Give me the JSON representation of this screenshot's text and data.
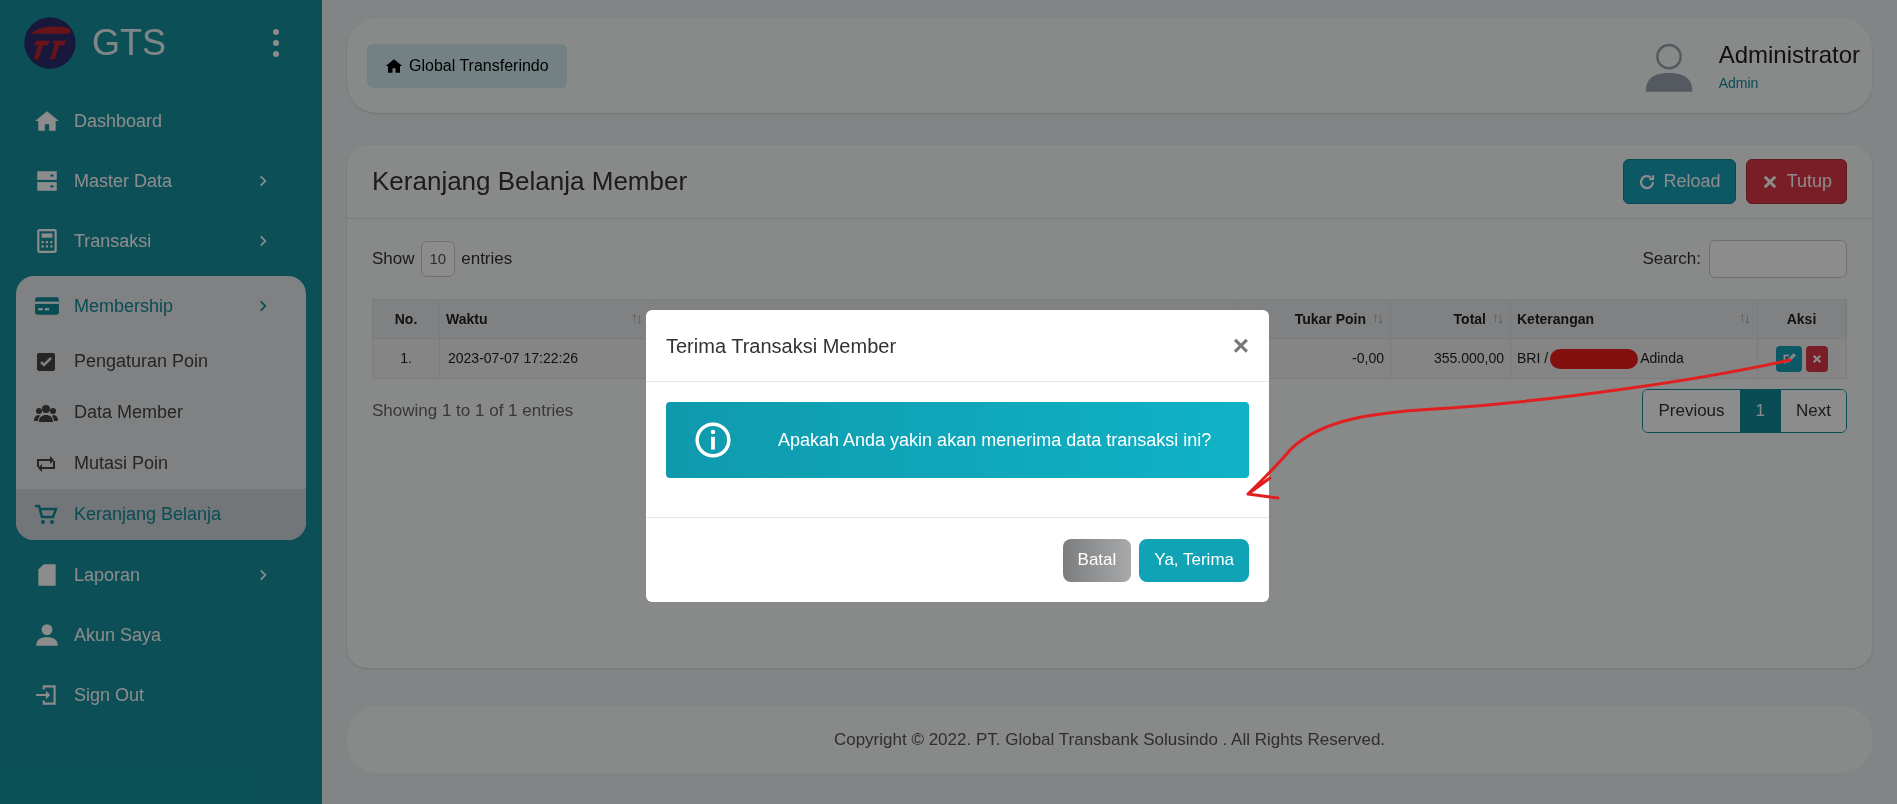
{
  "sidebar": {
    "brand": "GTS",
    "items": [
      {
        "label": "Dashboard",
        "has_submenu": false
      },
      {
        "label": "Master Data",
        "has_submenu": true,
        "expanded": false
      },
      {
        "label": "Transaksi",
        "has_submenu": true,
        "expanded": false
      },
      {
        "label": "Membership",
        "has_submenu": true,
        "expanded": true,
        "children": [
          {
            "label": "Pengaturan Poin",
            "selected": false
          },
          {
            "label": "Data Member",
            "selected": false
          },
          {
            "label": "Mutasi Poin",
            "selected": false
          },
          {
            "label": "Keranjang Belanja",
            "selected": true
          }
        ]
      },
      {
        "label": "Laporan",
        "has_submenu": true,
        "expanded": false
      },
      {
        "label": "Akun Saya",
        "has_submenu": false
      },
      {
        "label": "Sign Out",
        "has_submenu": false
      }
    ]
  },
  "header": {
    "breadcrumb": "Global Transferindo",
    "user": {
      "name": "Administrator",
      "role": "Admin"
    }
  },
  "card": {
    "title": "Keranjang Belanja Member",
    "buttons": [
      {
        "label": "Reload",
        "kind": "info"
      },
      {
        "label": "Tutup",
        "kind": "danger"
      }
    ],
    "length": {
      "prefix": "Show",
      "value": "10",
      "suffix": "entries"
    },
    "search_label": "Search:",
    "table": {
      "columns": [
        {
          "label": "No.",
          "sortable": false
        },
        {
          "label": "Waktu",
          "sortable": true
        },
        {
          "label": "Tukar Poin",
          "sortable": true
        },
        {
          "label": "Total",
          "sortable": true
        },
        {
          "label": "Keterangan",
          "sortable": true
        },
        {
          "label": "Aksi",
          "sortable": false
        }
      ],
      "rows": [
        {
          "cells": [
            "1.",
            "2023-07-07 17:22:26",
            "-0,00",
            "355.000,00"
          ],
          "note_start": "BRI /",
          "note_end": "Adinda"
        }
      ]
    },
    "info": "Showing 1 to 1 of 1 entries",
    "pagination": [
      {
        "label": "Previous",
        "selected": false
      },
      {
        "label": "1",
        "selected": true
      },
      {
        "label": "Next",
        "selected": false
      }
    ]
  },
  "footer": "Copyright © 2022. PT. Global Transbank Solusindo . All Rights Reserved.",
  "modal": {
    "title": "Terima Transaksi Member",
    "close": "×",
    "message": "Apakah Anda yakin akan menerima data transaksi ini?",
    "buttons": [
      {
        "label": "Batal",
        "kind": "secondary"
      },
      {
        "label": "Ya, Terima",
        "kind": "primary"
      }
    ]
  }
}
